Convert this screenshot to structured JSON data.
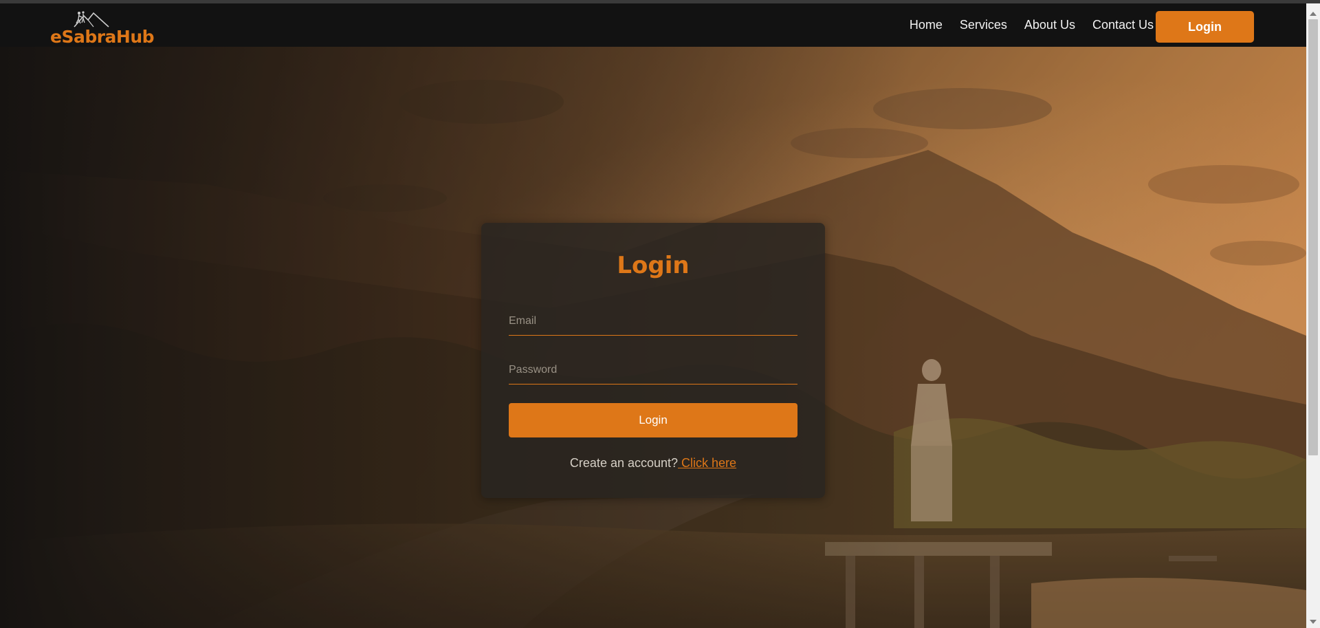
{
  "brand": {
    "name": "eSabraHub",
    "accent_color": "#de7718"
  },
  "nav": {
    "links": [
      {
        "label": "Home"
      },
      {
        "label": "Services"
      },
      {
        "label": "About Us"
      },
      {
        "label": "Contact Us"
      }
    ],
    "login_label": "Login"
  },
  "login_form": {
    "title": "Login",
    "email_placeholder": "Email",
    "password_placeholder": "Password",
    "submit_label": "Login",
    "signup_prompt": "Create an account?",
    "signup_link": " Click here"
  },
  "icons": {
    "logo": "mountain-hikers-logo-icon",
    "scroll_up": "scroll-up-arrow-icon",
    "scroll_down": "scroll-down-arrow-icon"
  }
}
